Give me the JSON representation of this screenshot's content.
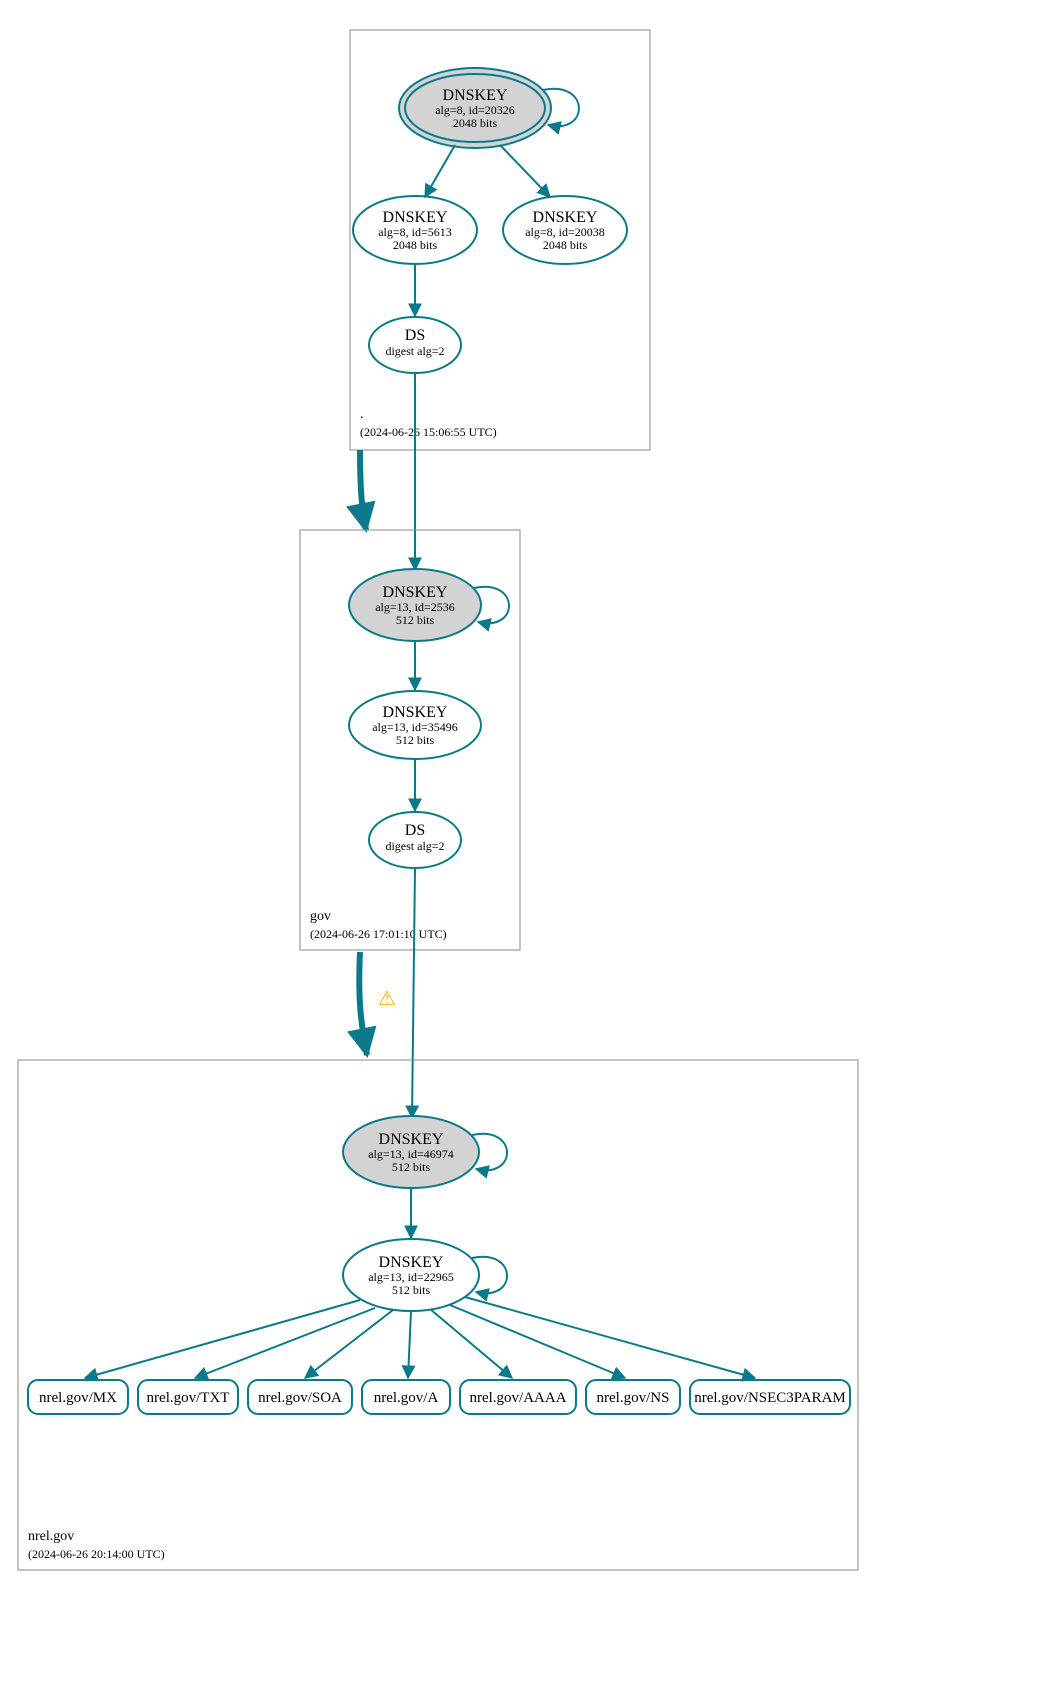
{
  "zones": {
    "root": {
      "name": ".",
      "timestamp": "(2024-06-26 15:06:55 UTC)",
      "dnskey_ksk": {
        "title": "DNSKEY",
        "alg": "alg=8, id=20326",
        "bits": "2048 bits"
      },
      "dnskey_zsk": {
        "title": "DNSKEY",
        "alg": "alg=8, id=5613",
        "bits": "2048 bits"
      },
      "dnskey_other": {
        "title": "DNSKEY",
        "alg": "alg=8, id=20038",
        "bits": "2048 bits"
      },
      "ds": {
        "title": "DS",
        "alg": "digest alg=2"
      }
    },
    "gov": {
      "name": "gov",
      "timestamp": "(2024-06-26 17:01:10 UTC)",
      "dnskey_ksk": {
        "title": "DNSKEY",
        "alg": "alg=13, id=2536",
        "bits": "512 bits"
      },
      "dnskey_zsk": {
        "title": "DNSKEY",
        "alg": "alg=13, id=35496",
        "bits": "512 bits"
      },
      "ds": {
        "title": "DS",
        "alg": "digest alg=2"
      }
    },
    "nrel": {
      "name": "nrel.gov",
      "timestamp": "(2024-06-26 20:14:00 UTC)",
      "dnskey_ksk": {
        "title": "DNSKEY",
        "alg": "alg=13, id=46974",
        "bits": "512 bits"
      },
      "dnskey_zsk": {
        "title": "DNSKEY",
        "alg": "alg=13, id=22965",
        "bits": "512 bits"
      },
      "rrsets": {
        "mx": "nrel.gov/MX",
        "txt": "nrel.gov/TXT",
        "soa": "nrel.gov/SOA",
        "a": "nrel.gov/A",
        "aaaa": "nrel.gov/AAAA",
        "ns": "nrel.gov/NS",
        "nsec3param": "nrel.gov/NSEC3PARAM"
      }
    }
  },
  "warning_icon": "⚠"
}
